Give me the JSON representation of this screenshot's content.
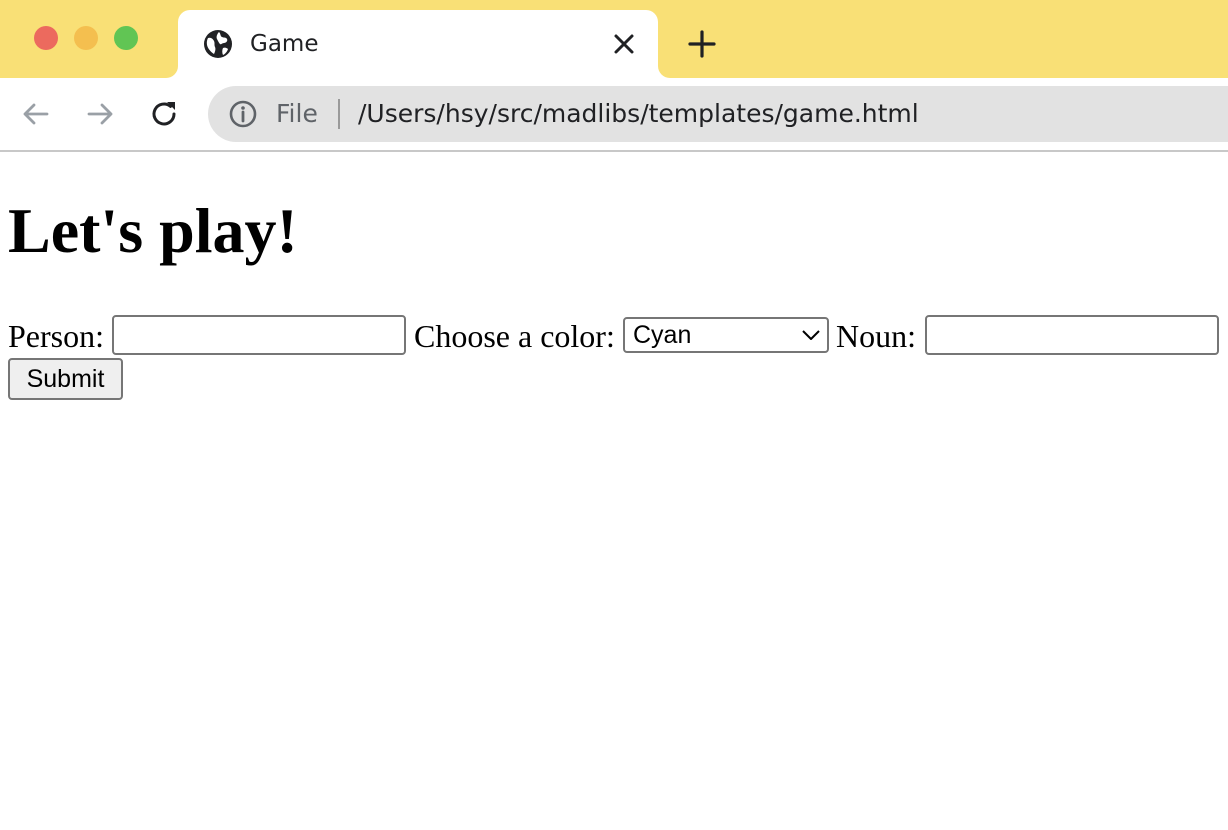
{
  "window": {
    "traffic_lights": {
      "close_color": "#ec6a5e",
      "minimize_color": "#f4bf4f",
      "maximize_color": "#61c554"
    },
    "tab_strip_color": "#f9e076"
  },
  "tab": {
    "title": "Game",
    "favicon": "globe-icon",
    "close_icon": "close-icon"
  },
  "new_tab_icon": "plus-icon",
  "toolbar": {
    "back_icon": "arrow-left-icon",
    "forward_icon": "arrow-right-icon",
    "reload_icon": "reload-icon",
    "omnibox": {
      "info_icon": "info-icon",
      "scheme": "File",
      "url": "/Users/hsy/src/madlibs/templates/game.html"
    }
  },
  "page": {
    "title": "Let's play!",
    "form": {
      "person_label": "Person:",
      "person_value": "",
      "color_label": "Choose a color:",
      "color_selected": "Cyan",
      "noun_label": "Noun:",
      "noun_value": "",
      "submit_label": "Submit"
    }
  }
}
